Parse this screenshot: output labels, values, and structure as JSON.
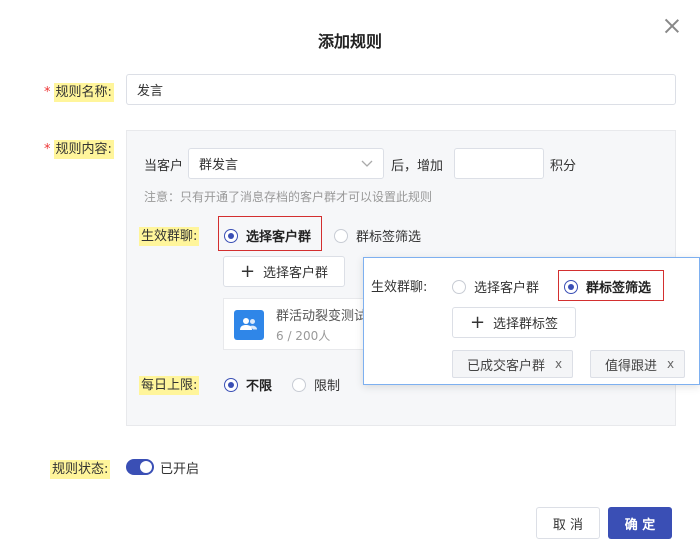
{
  "dialog": {
    "title": "添加规则"
  },
  "rule_name": {
    "label": "规则名称:",
    "value": "发言"
  },
  "rule_content": {
    "label": "规则内容:",
    "prefix": "当客户",
    "action_select": "群发言",
    "middle": "后，增加",
    "points_value": "",
    "suffix": "积分",
    "note": "注意：只有开通了消息存档的客户群才可以设置此规则"
  },
  "effective_group": {
    "label": "生效群聊:",
    "options": [
      "选择客户群",
      "群标签筛选"
    ],
    "selected": "选择客户群",
    "add_button": "选择客户群",
    "card": {
      "name": "群活动裂变测试",
      "count": "6 / 200人"
    }
  },
  "popover": {
    "label": "生效群聊:",
    "options": [
      "选择客户群",
      "群标签筛选"
    ],
    "selected": "群标签筛选",
    "add_button": "选择群标签",
    "tags": [
      "已成交客户群",
      "值得跟进"
    ]
  },
  "daily_limit": {
    "label": "每日上限:",
    "options": [
      "不限",
      "限制"
    ],
    "selected": "不限"
  },
  "rule_status": {
    "label": "规则状态:",
    "value": "已开启"
  },
  "footer": {
    "cancel": "取 消",
    "ok": "确 定"
  },
  "colors": {
    "primary": "#3a4fb5",
    "highlight": "#fff59b",
    "required": "#e33333",
    "annotation": "#d32f2f"
  }
}
